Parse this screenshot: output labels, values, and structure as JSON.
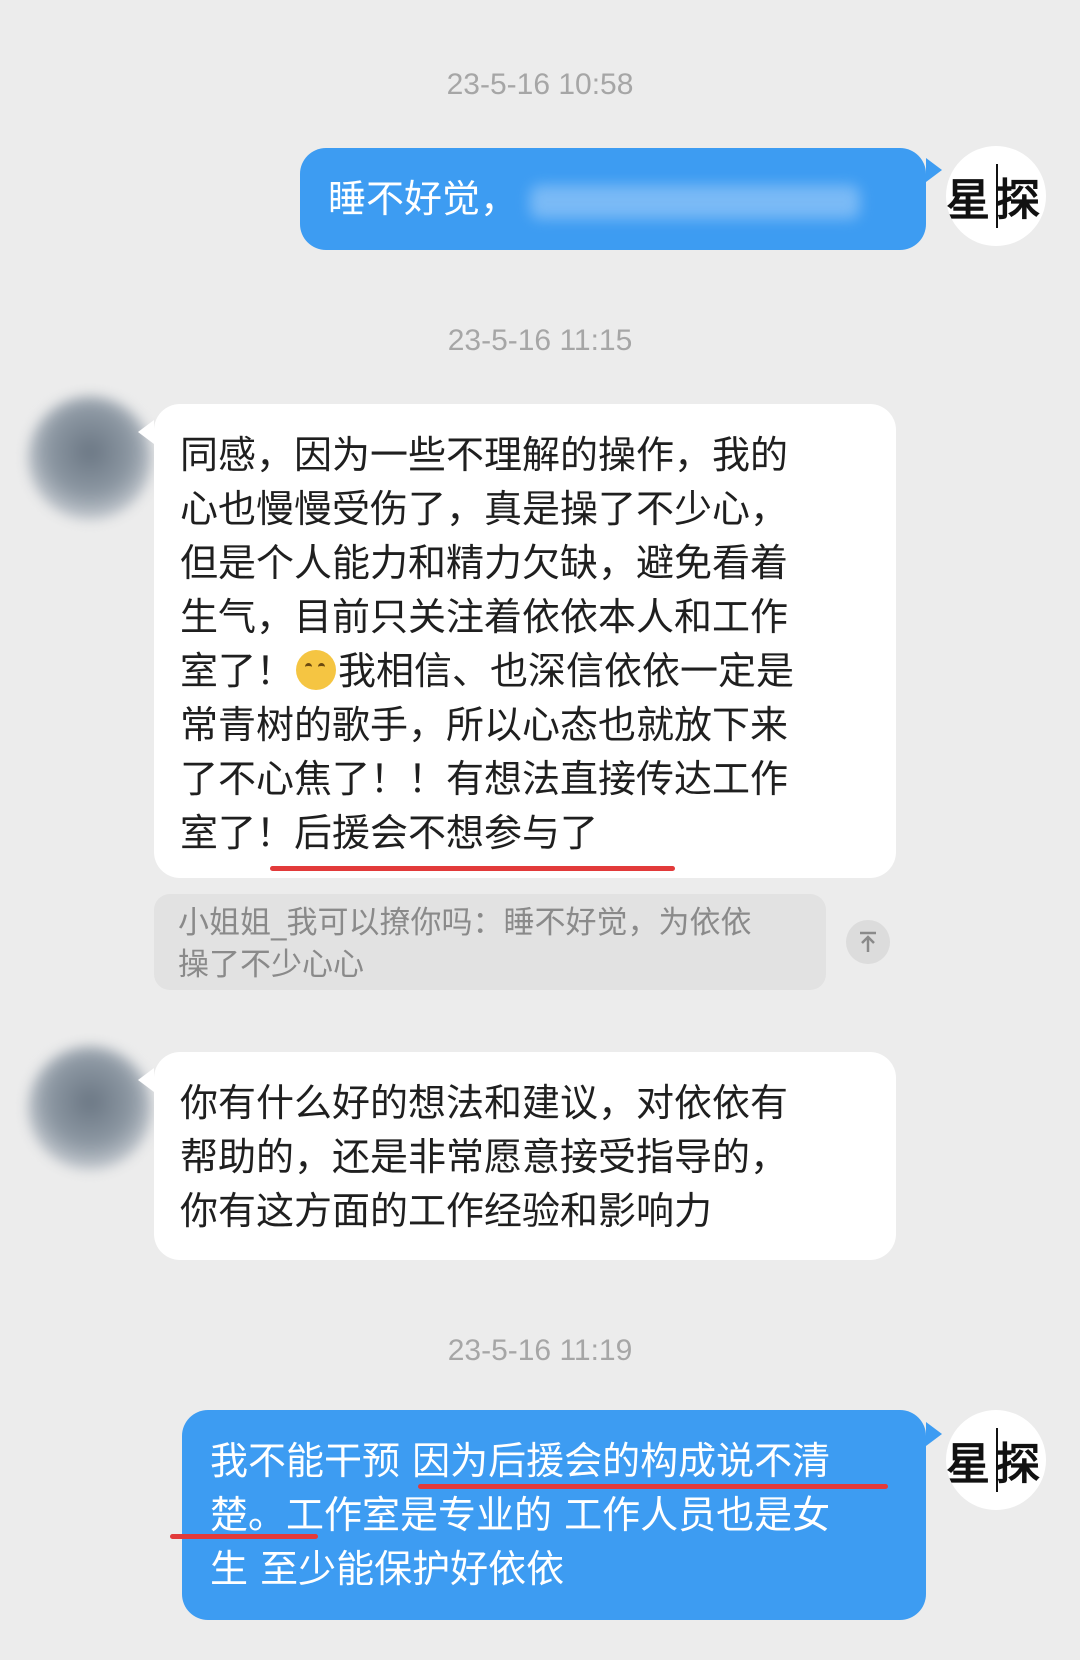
{
  "conversation": {
    "timestamps": [
      "23-5-16 10:58",
      "23-5-16 11:15",
      "23-5-16 11:19"
    ],
    "sender_avatar_text": "星探",
    "colors": {
      "outgoing": "#3d9cf2",
      "incoming": "#ffffff",
      "background": "#ececec",
      "highlight": "#e23a3a"
    },
    "msg1": {
      "text": "睡不好觉，"
    },
    "msg2": {
      "lines": [
        "同感，因为一些不理解的操作，我的",
        "心也慢慢受伤了，真是操了不少心，",
        "但是个人能力和精力欠缺，避免看着",
        "生气，目前只关注着依依本人和工作",
        "室了！",
        "我相信、也深信依依一定是",
        "常青树的歌手，所以心态也就放下来",
        "了不心焦了！！有想法直接传达工作",
        "室了！后援会不想参与了"
      ],
      "emoji": "crying-laughing-emoji"
    },
    "quote": {
      "lines": [
        "小姐姐_我可以撩你吗：睡不好觉，为依依",
        "操了不少心心"
      ],
      "top_icon": "arrow-up-to-top-icon"
    },
    "msg3": {
      "lines": [
        "你有什么好的想法和建议，对依依有",
        "帮助的，还是非常愿意接受指导的，",
        "你有这方面的工作经验和影响力"
      ]
    },
    "msg4": {
      "lines": [
        "我不能干预 因为后援会的构成说不清",
        "楚。工作室是专业的 工作人员也是女",
        "生 至少能保护好依依"
      ]
    }
  }
}
